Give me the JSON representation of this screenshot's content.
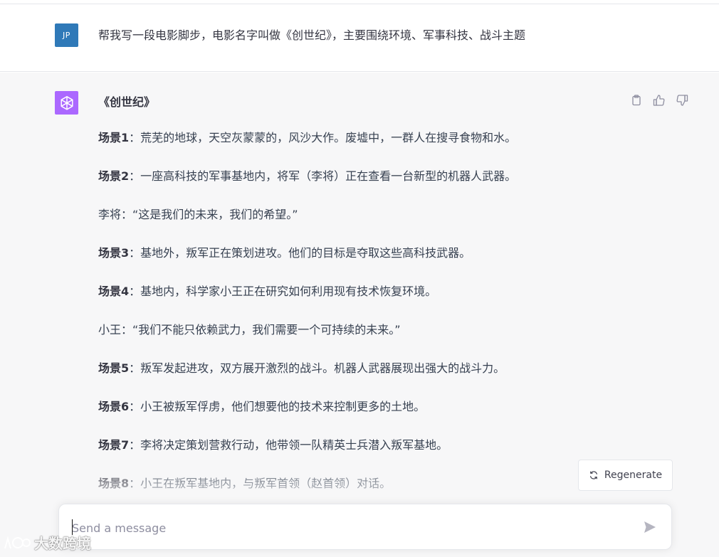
{
  "user_message": {
    "avatar_initials": "JP",
    "text": "帮我写一段电影脚步，电影名字叫做《创世纪》，主要围绕环境、军事科技、战斗主题"
  },
  "assistant_message": {
    "title": "《创世纪》",
    "paragraphs": [
      {
        "label": "场景1",
        "text": "：荒芜的地球，天空灰蒙蒙的，风沙大作。废墟中，一群人在搜寻食物和水。"
      },
      {
        "label": "场景2",
        "text": "：一座高科技的军事基地内，将军（李将）正在查看一台新型的机器人武器。"
      },
      {
        "label": "",
        "text": "李将：“这是我们的未来，我们的希望。”"
      },
      {
        "label": "场景3",
        "text": "：基地外，叛军正在策划进攻。他们的目标是夺取这些高科技武器。"
      },
      {
        "label": "场景4",
        "text": "：基地内，科学家小王正在研究如何利用现有技术恢复环境。"
      },
      {
        "label": "",
        "text": "小王：“我们不能只依赖武力，我们需要一个可持续的未来。”"
      },
      {
        "label": "场景5",
        "text": "：叛军发起进攻，双方展开激烈的战斗。机器人武器展现出强大的战斗力。"
      },
      {
        "label": "场景6",
        "text": "：小王被叛军俘虏，他们想要他的技术来控制更多的土地。"
      },
      {
        "label": "场景7",
        "text": "：李将决定策划营救行动，他带领一队精英士兵潜入叛军基地。"
      },
      {
        "label": "场景8",
        "text": "：小王在叛军基地内，与叛军首领（赵首领）对话。"
      }
    ]
  },
  "actions": {
    "copy_icon": "clipboard-icon",
    "like_icon": "thumbs-up-icon",
    "dislike_icon": "thumbs-down-icon"
  },
  "regenerate": {
    "label": "Regenerate",
    "icon": "refresh-icon"
  },
  "composer": {
    "placeholder": "Send a message",
    "value": "",
    "send_icon": "paper-plane-icon"
  },
  "watermark": {
    "text": "大数跨境"
  },
  "colors": {
    "user_avatar": "#2f79b8",
    "gpt_avatar": "#ab68ff",
    "assistant_bg": "#f7f7f8"
  }
}
